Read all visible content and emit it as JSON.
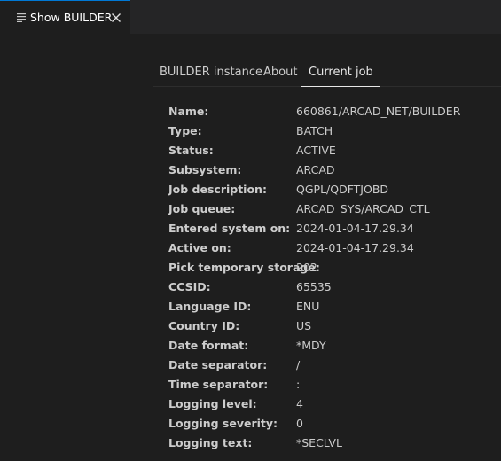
{
  "editor_tab": {
    "label": "Show BUILDER",
    "icon": "preview-lines-icon",
    "close_icon": "close-icon"
  },
  "panel_tabs": [
    {
      "label": "BUILDER instance",
      "active": false
    },
    {
      "label": "About",
      "active": false
    },
    {
      "label": "Current job",
      "active": true
    }
  ],
  "job": [
    {
      "key": "Name:",
      "value": "660861/ARCAD_NET/BUILDER"
    },
    {
      "key": "Type:",
      "value": "BATCH"
    },
    {
      "key": "Status:",
      "value": "ACTIVE"
    },
    {
      "key": "Subsystem:",
      "value": "ARCAD"
    },
    {
      "key": "Job description:",
      "value": "QGPL/QDFTJOBD"
    },
    {
      "key": "Job queue:",
      "value": "ARCAD_SYS/ARCAD_CTL"
    },
    {
      "key": "Entered system on:",
      "value": "2024-01-04-17.29.34"
    },
    {
      "key": "Active on:",
      "value": "2024-01-04-17.29.34"
    },
    {
      "key": "Pick temporary storage:",
      "value": "202"
    },
    {
      "key": "CCSID:",
      "value": "65535"
    },
    {
      "key": "Language ID:",
      "value": "ENU"
    },
    {
      "key": "Country ID:",
      "value": "US"
    },
    {
      "key": "Date format:",
      "value": "*MDY"
    },
    {
      "key": "Date separator:",
      "value": "/"
    },
    {
      "key": "Time separator:",
      "value": ":"
    },
    {
      "key": "Logging level:",
      "value": "4"
    },
    {
      "key": "Logging severity:",
      "value": "0"
    },
    {
      "key": "Logging text:",
      "value": "*SECLVL"
    }
  ],
  "colors": {
    "background": "#1e1e1e",
    "tabstrip": "#252526",
    "text": "#cccccc",
    "accent": "#0078d4"
  }
}
